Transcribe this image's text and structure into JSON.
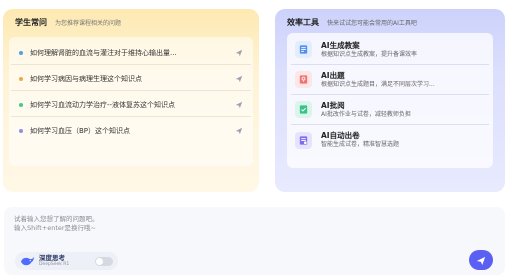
{
  "colors": {
    "left_header": "#fde9b1",
    "right_header": "#cdd2fb",
    "send_button": "#5b5ff2",
    "dot_1": "#4aa3e6",
    "dot_2": "#f0a94a",
    "dot_3": "#48c98a",
    "dot_4": "#8d8fef"
  },
  "student_faq": {
    "title": "学生常问",
    "subtitle": "为您推荐课程相关的问题",
    "questions": [
      {
        "label": "如何理解肾脏的血流与灌注对于维持心输出量...",
        "icon": "send-arrow-icon"
      },
      {
        "label": "如何学习病因与病理生理这个知识点",
        "icon": "send-arrow-icon"
      },
      {
        "label": "如何学习血流动力学治疗--液体复苏这个知识点",
        "icon": "send-arrow-icon"
      },
      {
        "label": "如何学习血压（BP）这个知识点",
        "icon": "send-arrow-icon"
      }
    ]
  },
  "tools": {
    "title": "效率工具",
    "subtitle": "快来试试您可能会常用的AI工具吧",
    "items": [
      {
        "name": "AI生成教案",
        "desc": "根据知识点生成教案，提升备课效率",
        "icon": "lesson-plan-icon",
        "color": "#4d8ef0"
      },
      {
        "name": "AI出题",
        "desc": "根据知识点生成题目，满足不同层次学习...",
        "icon": "question-gen-icon",
        "color": "#f07373"
      },
      {
        "name": "AI批阅",
        "desc": "AI批改作业与试卷，减轻教师负担",
        "icon": "grading-icon",
        "color": "#36c38a"
      },
      {
        "name": "AI自动出卷",
        "desc": "智能生成试卷，精准智慧选题",
        "icon": "exam-paper-icon",
        "color": "#7b6cf0"
      }
    ]
  },
  "input": {
    "placeholder_line1": "试着输入您想了解的问题吧。",
    "placeholder_line2": "输入Shift+enter是换行哦~"
  },
  "mode": {
    "name": "深度思考",
    "sub": "DeepSeek R1",
    "toggle_on": false
  }
}
